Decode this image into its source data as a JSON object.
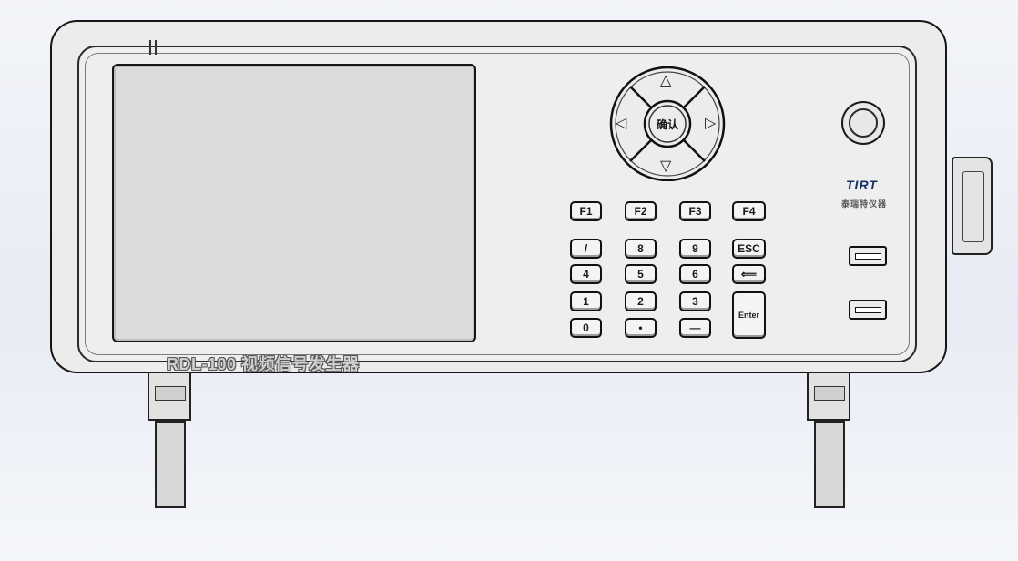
{
  "device": {
    "model_label": "RDL-100 视频信号发生器",
    "brand_logo": "TIRT",
    "brand_cn": "泰瑞特仪器",
    "accent_color": "#16306a",
    "logo_accent": "#b31b1b"
  },
  "dpad": {
    "up_icon": "△",
    "down_icon": "▽",
    "left_icon": "◁",
    "right_icon": "▷",
    "confirm_label": "确认"
  },
  "function_keys": [
    "F1",
    "F2",
    "F3",
    "F4"
  ],
  "keypad": {
    "row1": [
      "/",
      "8",
      "9",
      "ESC"
    ],
    "row2": [
      "4",
      "5",
      "6",
      "⟸"
    ],
    "row3": [
      "1",
      "2",
      "3"
    ],
    "row4": [
      "0",
      "•",
      "—"
    ],
    "enter_label": "Enter"
  },
  "icons": [
    "knob-icon",
    "usb-port-icon",
    "side-connector-icon"
  ]
}
